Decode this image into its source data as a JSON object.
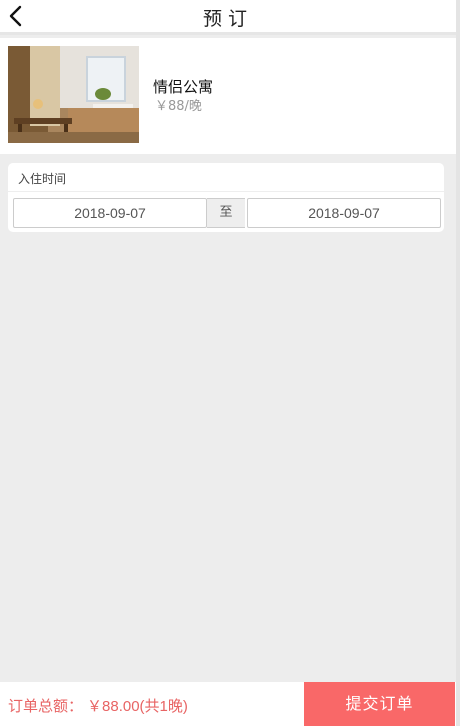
{
  "header": {
    "title": "预订",
    "back_icon": "chevron-left-icon"
  },
  "room": {
    "name": "情侣公寓",
    "price": "￥88/晚",
    "photo_alt": "room-photo"
  },
  "checkin": {
    "label": "入住时间",
    "start_date": "2018-09-07",
    "separator": "至",
    "end_date": "2018-09-07"
  },
  "footer": {
    "total_label": "订单总额：",
    "total_value": "￥88.00(共1晚)",
    "submit_label": "提交订单"
  },
  "colors": {
    "accent": "#f96868",
    "background": "#ededed",
    "total_text": "#e86464"
  }
}
